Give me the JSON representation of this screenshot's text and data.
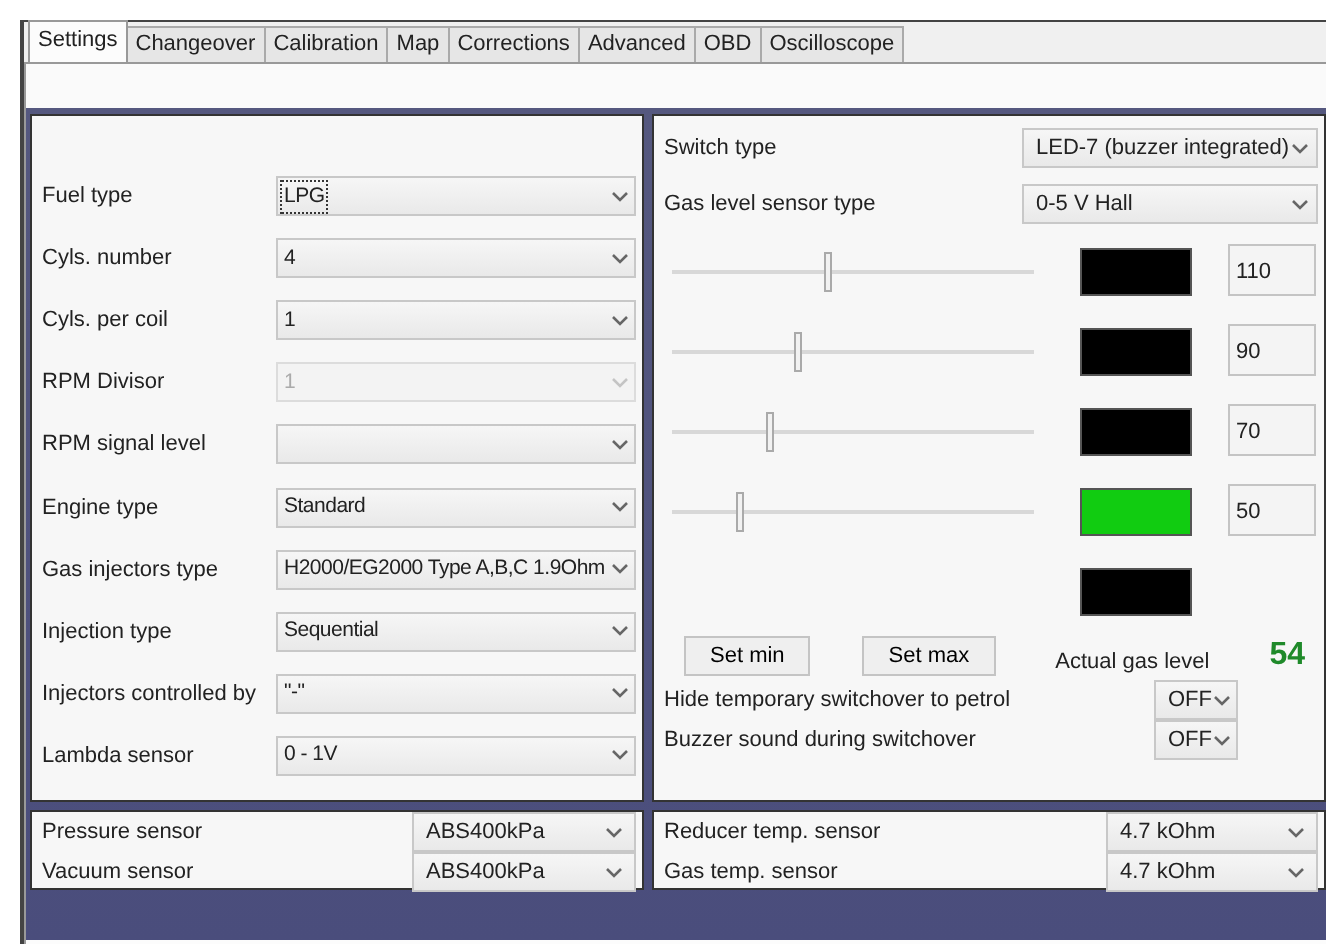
{
  "tabs": [
    {
      "label": "Settings",
      "selected": true
    },
    {
      "label": "Changeover",
      "selected": false
    },
    {
      "label": "Calibration",
      "selected": false
    },
    {
      "label": "Map",
      "selected": false
    },
    {
      "label": "Corrections",
      "selected": false
    },
    {
      "label": "Advanced",
      "selected": false
    },
    {
      "label": "OBD",
      "selected": false
    },
    {
      "label": "Oscilloscope",
      "selected": false
    }
  ],
  "engine_settings": [
    {
      "label": "Fuel type",
      "value": "LPG",
      "disabled": false,
      "focused": true
    },
    {
      "label": "Cyls. number",
      "value": "4",
      "disabled": false,
      "focused": false
    },
    {
      "label": "Cyls. per coil",
      "value": "1",
      "disabled": false,
      "focused": false
    },
    {
      "label": "RPM Divisor",
      "value": "1",
      "disabled": true,
      "focused": false
    },
    {
      "label": "RPM signal level",
      "disabled": false,
      "focused": false
    },
    {
      "label": "Engine type",
      "value": "Standard",
      "disabled": false,
      "focused": false
    },
    {
      "label": "Gas injectors type",
      "value": "H2000/EG2000 Type A,B,C 1.9Ohm",
      "disabled": false,
      "focused": false
    },
    {
      "label": "Injection type",
      "value": "Sequential",
      "disabled": false,
      "focused": false
    },
    {
      "label": "Injectors controlled by",
      "value": "\"-\"",
      "disabled": false,
      "focused": false
    },
    {
      "label": "Lambda sensor",
      "value": "0 - 1V",
      "disabled": false,
      "focused": false
    }
  ],
  "switch_settings": [
    {
      "label": "Switch type",
      "value": "LED-7 (buzzer integrated)"
    },
    {
      "label": "Gas level sensor type",
      "value": "0-5 V Hall"
    }
  ],
  "thresholds": [
    {
      "level": 0.43,
      "value": "110"
    },
    {
      "level": 0.35,
      "value": "90"
    },
    {
      "level": 0.27,
      "value": "70"
    },
    {
      "level": 0.19,
      "value": "50"
    }
  ],
  "level_indicators": [
    {
      "color": "#000000"
    },
    {
      "color": "#000000"
    },
    {
      "color": "#000000"
    },
    {
      "color": "#11cc11"
    },
    {
      "color": "#000000"
    }
  ],
  "buttons": [
    "Set min",
    "Set max"
  ],
  "actual_gas_level": {
    "label": "Actual gas level",
    "value": "54"
  },
  "toggles": [
    {
      "label": "Hide temporary switchover to petrol",
      "value": "OFF"
    },
    {
      "label": "Buzzer sound during switchover",
      "value": "OFF"
    }
  ],
  "pressure_sensors": [
    {
      "label": "Pressure sensor",
      "value": "ABS400kPa"
    },
    {
      "label": "Vacuum sensor",
      "value": "ABS400kPa"
    }
  ],
  "temperature_sensors": [
    {
      "label": "Reducer temp. sensor",
      "value": "4.7 kOhm"
    },
    {
      "label": "Gas temp. sensor",
      "value": "4.7 kOhm"
    }
  ]
}
